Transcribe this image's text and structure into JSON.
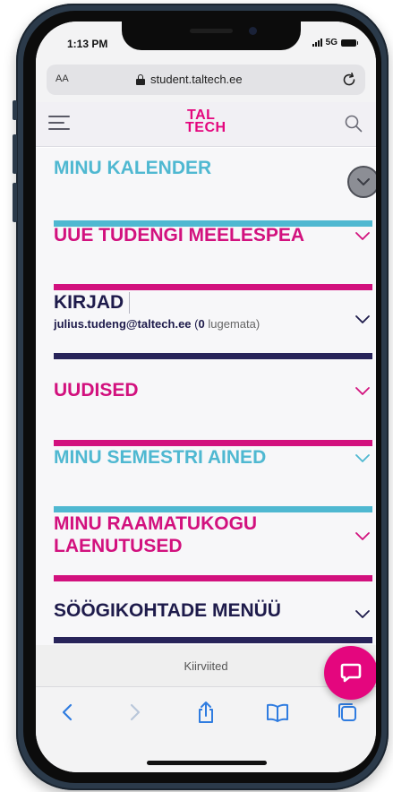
{
  "status_bar": {
    "time": "1:13 PM",
    "network": "5G"
  },
  "browser": {
    "text_size_label": "AA",
    "url": "student.taltech.ee",
    "reload_icon": "reload-icon",
    "lock_icon": "lock-icon"
  },
  "site_header": {
    "logo_line1": "TAL",
    "logo_line2": "TECH",
    "brand_color": "#e4067e"
  },
  "sections": [
    {
      "title": "MINU KALENDER",
      "color": "#4fb8d1",
      "bar_color": "#4fb8d1"
    },
    {
      "title": "UUE TUDENGI MEELESPEA",
      "color": "#d2117e",
      "bar_color": "#d2117e"
    },
    {
      "title": "KIRJAD",
      "color": "#1e1b4b",
      "bar_color": "#28245a",
      "email": "julius.tudeng@taltech.ee",
      "count_open": "(",
      "unread_count": "0",
      "unread_label": "lugemata)"
    },
    {
      "title": "UUDISED",
      "color": "#d2117e",
      "bar_color": "#d2117e"
    },
    {
      "title": "MINU SEMESTRI AINED",
      "color": "#4fb8d1",
      "bar_color": "#4fb8d1"
    },
    {
      "title_line1": "MINU RAAMATUKOGU",
      "title_line2": "LAENUTUSED",
      "color": "#d2117e",
      "bar_color": "#d2117e"
    },
    {
      "title": "SÖÖGIKOHTADE MENÜÜ",
      "color": "#1e1b4b",
      "bar_color": "#28245a"
    }
  ],
  "footer": {
    "text": "Kiirviited"
  },
  "colors": {
    "cyan": "#4fb8d1",
    "magenta": "#d2117e",
    "navy": "#1e1b4b",
    "toolbar_blue": "#2f7ce0"
  }
}
